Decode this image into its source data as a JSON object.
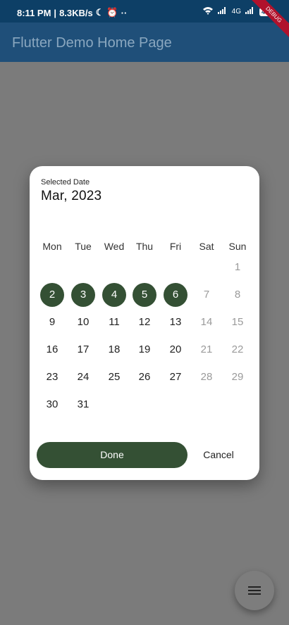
{
  "status_bar": {
    "time": "8:11 PM",
    "speed": "8.3KB/s",
    "network_label": "4G",
    "battery": "48"
  },
  "app_bar": {
    "title": "Flutter Demo Home Page",
    "debug_banner": "DEBUG"
  },
  "dialog": {
    "selected_label": "Selected Date",
    "selected_value": "Mar, 2023",
    "weekdays": [
      "Mon",
      "Tue",
      "Wed",
      "Thu",
      "Fri",
      "Sat",
      "Sun"
    ],
    "days": [
      "1",
      "2",
      "3",
      "4",
      "5",
      "6",
      "7",
      "8",
      "9",
      "10",
      "11",
      "12",
      "13",
      "14",
      "15",
      "16",
      "17",
      "18",
      "19",
      "20",
      "21",
      "22",
      "23",
      "24",
      "25",
      "26",
      "27",
      "28",
      "29",
      "30",
      "31"
    ],
    "selected_days": [
      "2",
      "3",
      "4",
      "5",
      "6"
    ],
    "done_label": "Done",
    "cancel_label": "Cancel"
  },
  "fab": {
    "icon": "menu-lines-icon"
  }
}
